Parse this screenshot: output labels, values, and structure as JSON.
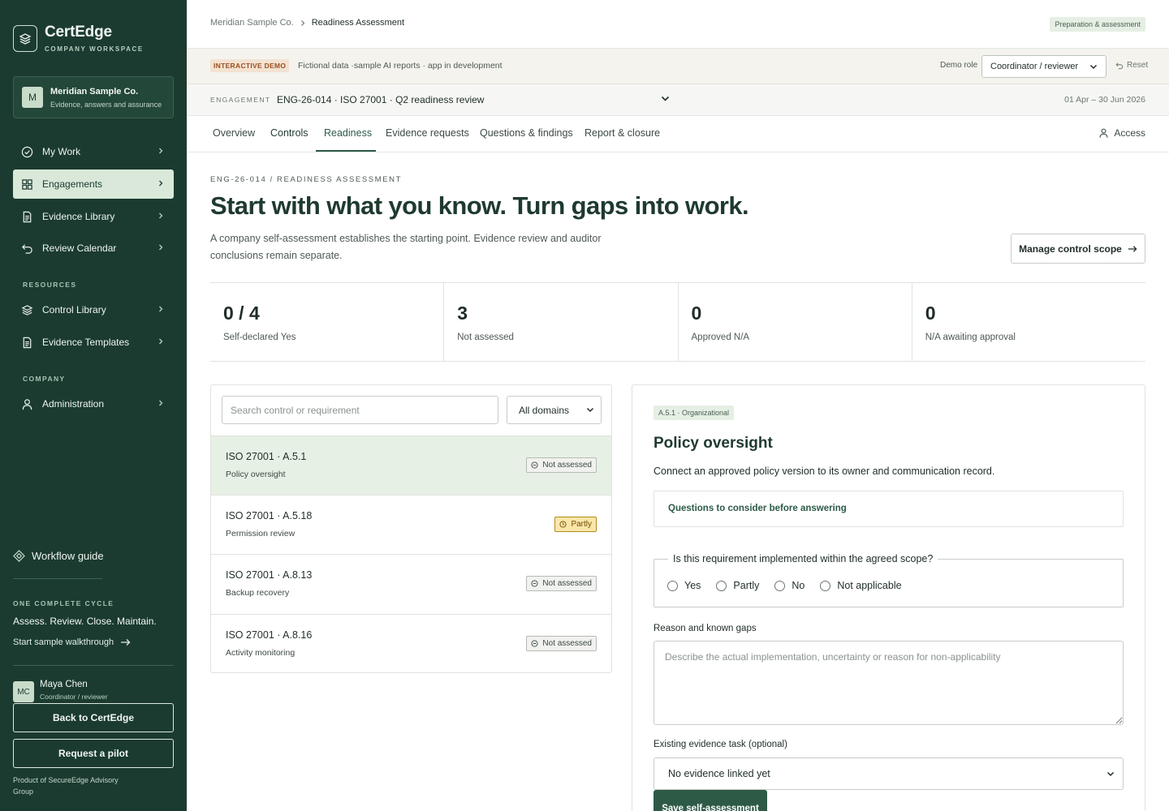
{
  "sidebar": {
    "brand_name": "CertEdge",
    "brand_sub": "COMPANY WORKSPACE",
    "company": {
      "initial": "M",
      "name": "Meridian Sample Co.",
      "desc": "Evidence, answers and assurance"
    },
    "nav": [
      {
        "label": "My Work",
        "icon": "check-circle-icon",
        "active": false
      },
      {
        "label": "Engagements",
        "icon": "grid-icon",
        "active": true
      },
      {
        "label": "Evidence Library",
        "icon": "document-icon",
        "active": false
      },
      {
        "label": "Review Calendar",
        "icon": "undo-icon",
        "active": false
      }
    ],
    "resources_label": "RESOURCES",
    "resources": [
      {
        "label": "Control Library",
        "icon": "layers-icon"
      },
      {
        "label": "Evidence Templates",
        "icon": "document-icon"
      }
    ],
    "company_label": "COMPANY",
    "company_nav": [
      {
        "label": "Administration",
        "icon": "user-icon"
      }
    ],
    "workflow_guide": "Workflow guide",
    "cycle_label": "ONE COMPLETE CYCLE",
    "cycle_text": "Assess. Review. Close. Maintain.",
    "walkthrough": "Start sample walkthrough",
    "user": {
      "initials": "MC",
      "name": "Maya Chen",
      "role": "Coordinator / reviewer"
    },
    "back_button": "Back to CertEdge",
    "pilot_button": "Request a pilot",
    "product_of": "Product of SecureEdge Advisory Group"
  },
  "topbar": {
    "breadcrumb": [
      "Meridian Sample Co.",
      "Readiness Assessment"
    ],
    "phase_badge": "Preparation & assessment"
  },
  "demo": {
    "badge": "INTERACTIVE DEMO",
    "text": "Fictional data ·sample AI reports · app in development",
    "role_label": "Demo role",
    "role_value": "Coordinator / reviewer",
    "reset": "Reset"
  },
  "engagement": {
    "label": "ENGAGEMENT",
    "value": "ENG-26-014 · ISO 27001 · Q2 readiness review",
    "dates": "01 Apr – 30 Jun 2026"
  },
  "tabs": [
    "Overview",
    "Controls",
    "Readiness",
    "Evidence requests",
    "Questions & findings",
    "Report & closure"
  ],
  "access": "Access",
  "page": {
    "eyebrow": "ENG-26-014 / READINESS ASSESSMENT",
    "headline": "Start with what you know. Turn gaps into work.",
    "lede": "A company self-assessment establishes the starting point. Evidence review and auditor conclusions remain separate.",
    "manage_button": "Manage control scope"
  },
  "stats": [
    {
      "value": "0 / 4",
      "label": "Self-declared Yes"
    },
    {
      "value": "3",
      "label": "Not assessed"
    },
    {
      "value": "0",
      "label": "Approved N/A"
    },
    {
      "value": "0",
      "label": "N/A awaiting approval"
    }
  ],
  "list": {
    "search_placeholder": "Search control or requirement",
    "domain_value": "All domains",
    "rows": [
      {
        "title": "ISO 27001 · A.5.1",
        "sub": "Policy oversight",
        "status": "Not assessed"
      },
      {
        "title": "ISO 27001 · A.5.18",
        "sub": "Permission review",
        "status": "Partly"
      },
      {
        "title": "ISO 27001 · A.8.13",
        "sub": "Backup recovery",
        "status": "Not assessed"
      },
      {
        "title": "ISO 27001 · A.8.16",
        "sub": "Activity monitoring",
        "status": "Not assessed"
      }
    ]
  },
  "detail": {
    "badge": "A.5.1 · Organizational",
    "title": "Policy oversight",
    "desc": "Connect an approved policy version to its owner and communication record.",
    "questions": "Questions to consider before answering",
    "legend": "Is this requirement implemented within the agreed scope?",
    "options": [
      "Yes",
      "Partly",
      "No",
      "Not applicable"
    ],
    "reason_label": "Reason and known gaps",
    "reason_placeholder": "Describe the actual implementation, uncertainty or reason for non-applicability",
    "evidence_label": "Existing evidence task (optional)",
    "evidence_value": "No evidence linked yet",
    "save_button": "Save self-assessment"
  }
}
